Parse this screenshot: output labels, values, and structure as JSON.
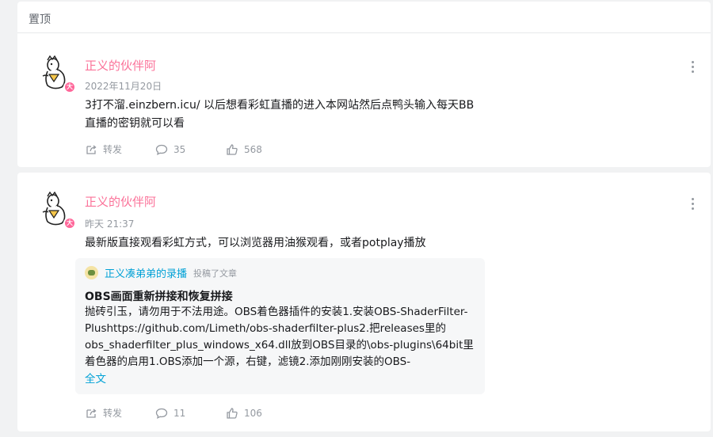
{
  "pinned_section": {
    "label": "置顶"
  },
  "posts": [
    {
      "author": "正义的伙伴阿",
      "avatar_badge": "大",
      "time": "2022年11月20日",
      "content": "3打不溜.einzbern.icu/ 以后想看彩虹直播的进入本网站然后点鸭头输入每天BB直播的密钥就可以看",
      "actions": {
        "share_label": "转发",
        "comment_count": "35",
        "like_count": "568"
      }
    },
    {
      "author": "正义的伙伴阿",
      "avatar_badge": "大",
      "time": "昨天 21:37",
      "content": "最新版直接观看彩虹方式，可以浏览器用油猴观看，或者potplay播放",
      "embed": {
        "up_name": "正义凑弟弟的录播",
        "up_action": "投稿了文章",
        "title": "OBS画面重新拼接和恢复拼接",
        "summary": "抛砖引玉，请勿用于不法用途。OBS着色器插件的安装1.安装OBS-ShaderFilter-Plushttps://github.com/Limeth/obs-shaderfilter-plus2.把releases里的obs_shaderfilter_plus_windows_x64.dll放到OBS目录的\\obs-plugins\\64bit里着色器的启用1.OBS添加一个源，右键，滤镜2.添加刚刚安装的OBS-ShaderFilte...",
        "read_more": "全文"
      },
      "actions": {
        "share_label": "转发",
        "comment_count": "11",
        "like_count": "106"
      }
    }
  ]
}
